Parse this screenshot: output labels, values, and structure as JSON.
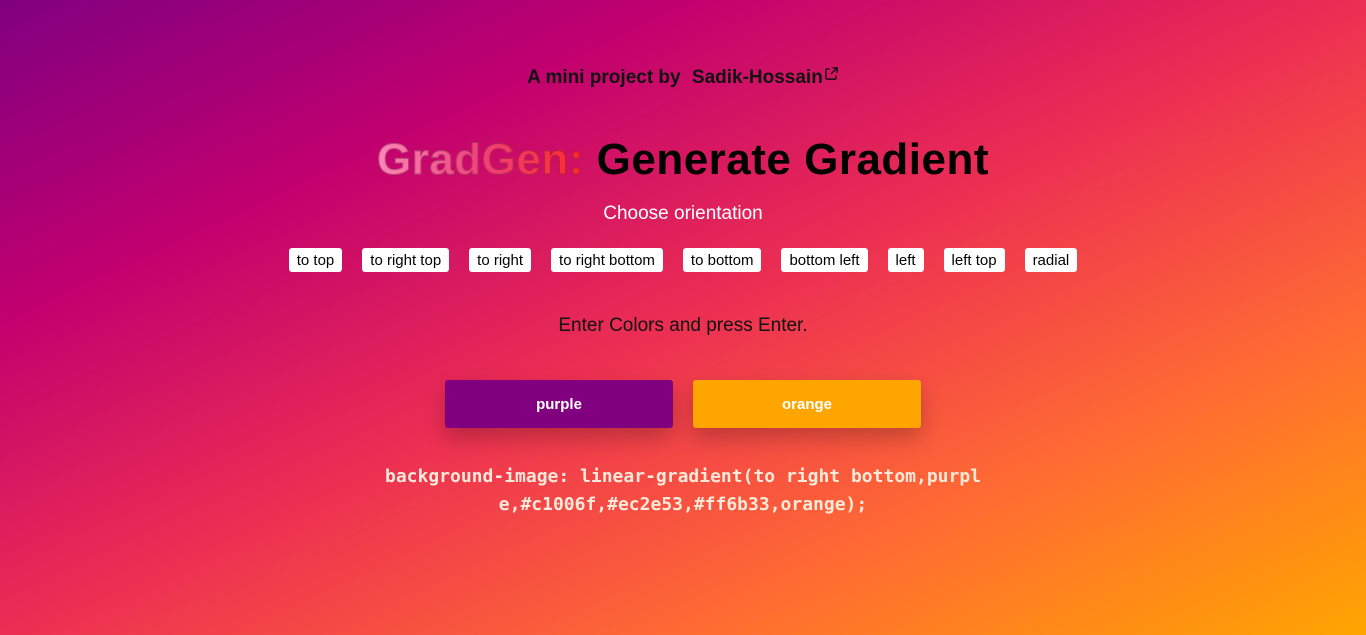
{
  "byline": {
    "prefix": "A mini project by",
    "author": "Sadik-Hossain",
    "link_icon": "external-link-icon"
  },
  "title": {
    "brand": "GradGen:",
    "rest": "Generate Gradient"
  },
  "orientation": {
    "label": "Choose orientation",
    "options": [
      "to top",
      "to right top",
      "to right",
      "to right bottom",
      "to bottom",
      "bottom left",
      "left",
      "left top",
      "radial"
    ],
    "selected": "to right bottom"
  },
  "colors": {
    "label": "Enter Colors and press Enter.",
    "inputs": [
      {
        "value": "purple",
        "bg": "#800080"
      },
      {
        "value": "orange",
        "bg": "#ffa500"
      }
    ]
  },
  "output": {
    "css": "background-image: linear-gradient(to right bottom,purple,#c1006f,#ec2e53,#ff6b33,orange);"
  },
  "theme": {
    "gradient_stops": [
      "purple",
      "#c1006f",
      "#ec2e53",
      "#ff6b33",
      "orange"
    ]
  }
}
